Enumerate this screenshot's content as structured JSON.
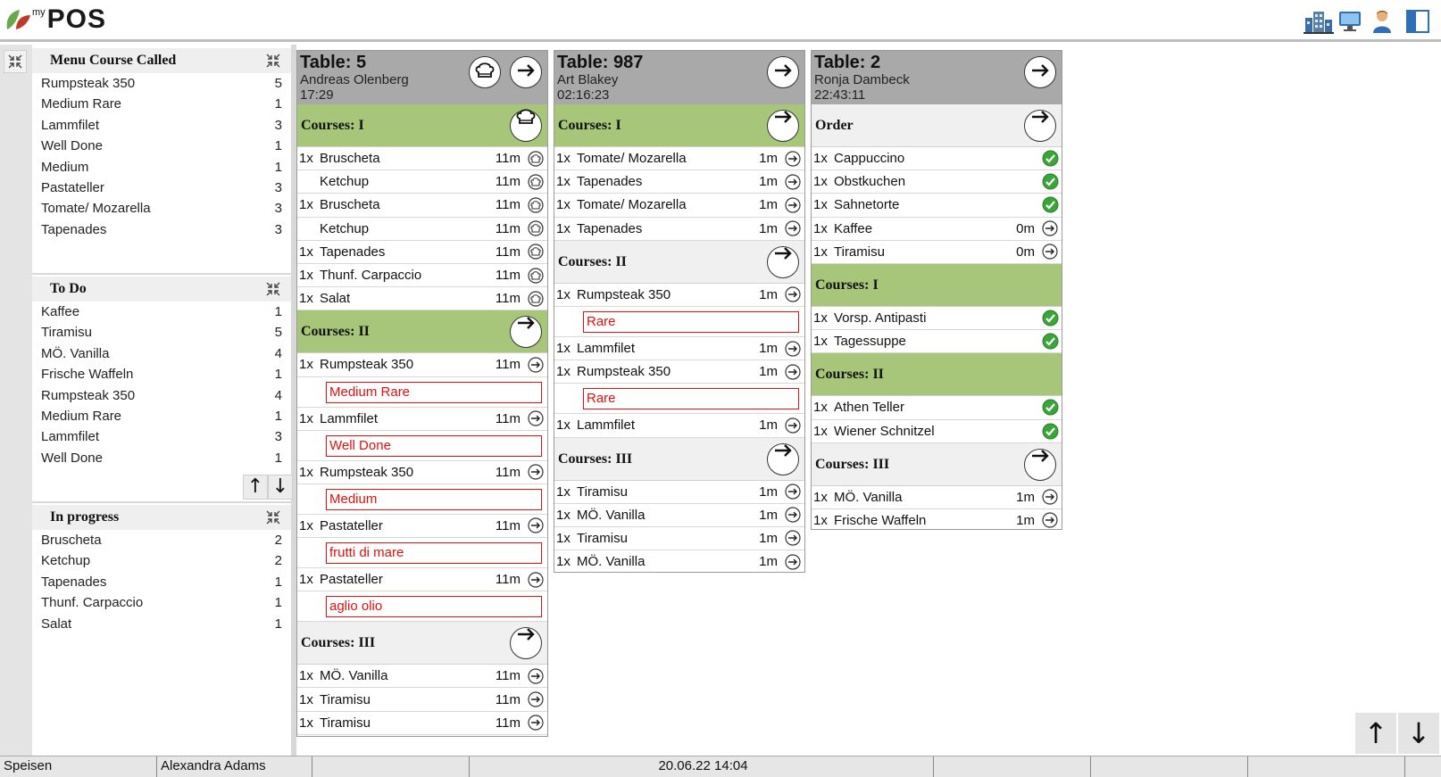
{
  "app": {
    "logo_my": "my",
    "logo_name": "POS"
  },
  "top_icons": [
    "building-icon",
    "monitor-icon",
    "user-icon",
    "panel-icon"
  ],
  "sidebar": {
    "menu": {
      "title": "Menu Course Called",
      "rows": [
        [
          "Rumpsteak 350",
          "5"
        ],
        [
          "Medium Rare",
          "1"
        ],
        [
          "Lammfilet",
          "3"
        ],
        [
          "Well Done",
          "1"
        ],
        [
          "Medium",
          "1"
        ],
        [
          "Pastateller",
          "3"
        ],
        [
          "Tomate/ Mozarella",
          "3"
        ],
        [
          "Tapenades",
          "3"
        ]
      ]
    },
    "todo": {
      "title": "To Do",
      "rows": [
        [
          "Kaffee",
          "1"
        ],
        [
          "Tiramisu",
          "5"
        ],
        [
          "MÖ. Vanilla",
          "4"
        ],
        [
          "Frische Waffeln",
          "1"
        ],
        [
          "Rumpsteak 350",
          "4"
        ],
        [
          "Medium Rare",
          "1"
        ],
        [
          "Lammfilet",
          "3"
        ],
        [
          "Well Done",
          "1"
        ]
      ]
    },
    "progress": {
      "title": "In progress",
      "rows": [
        [
          "Bruscheta",
          "2"
        ],
        [
          "Ketchup",
          "2"
        ],
        [
          "Tapenades",
          "1"
        ],
        [
          "Thunf. Carpaccio",
          "1"
        ],
        [
          "Salat",
          "1"
        ]
      ]
    },
    "scroll_up": "↑",
    "scroll_down": "↓"
  },
  "cards": [
    {
      "title": "Table: 5",
      "waiter": "Andreas Olenberg",
      "time": "17:29",
      "sections": [
        {
          "label": "Courses: I",
          "style": "green",
          "btn": "chef",
          "items": [
            {
              "q": "1x",
              "n": "Bruscheta",
              "t": "11m",
              "icon": "chef"
            },
            {
              "q": "",
              "n": "Ketchup",
              "t": "11m",
              "icon": "chef"
            },
            {
              "q": "1x",
              "n": "Bruscheta",
              "t": "11m",
              "icon": "chef"
            },
            {
              "q": "",
              "n": "Ketchup",
              "t": "11m",
              "icon": "chef"
            },
            {
              "q": "1x",
              "n": "Tapenades",
              "t": "11m",
              "icon": "chef"
            },
            {
              "q": "1x",
              "n": "Thunf. Carpaccio",
              "t": "11m",
              "icon": "chef"
            },
            {
              "q": "1x",
              "n": "Salat",
              "t": "11m",
              "icon": "chef"
            }
          ]
        },
        {
          "label": "Courses: II",
          "style": "green",
          "btn": "arrow",
          "items": [
            {
              "q": "1x",
              "n": "Rumpsteak 350",
              "t": "11m",
              "icon": "arrow",
              "note": "Medium Rare"
            },
            {
              "q": "1x",
              "n": "Lammfilet",
              "t": "11m",
              "icon": "arrow",
              "note": "Well Done"
            },
            {
              "q": "1x",
              "n": "Rumpsteak 350",
              "t": "11m",
              "icon": "arrow",
              "note": "Medium"
            },
            {
              "q": "1x",
              "n": "Pastateller",
              "t": "11m",
              "icon": "arrow",
              "note": "frutti di mare"
            },
            {
              "q": "1x",
              "n": "Pastateller",
              "t": "11m",
              "icon": "arrow",
              "note": "aglio olio"
            }
          ]
        },
        {
          "label": "Courses: III",
          "style": "gray",
          "btn": "arrow",
          "items": [
            {
              "q": "1x",
              "n": "MÖ. Vanilla",
              "t": "11m",
              "icon": "arrow"
            },
            {
              "q": "1x",
              "n": "Tiramisu",
              "t": "11m",
              "icon": "arrow"
            },
            {
              "q": "1x",
              "n": "Tiramisu",
              "t": "11m",
              "icon": "arrow"
            }
          ]
        }
      ]
    },
    {
      "title": "Table: 987",
      "waiter": "Art Blakey",
      "time": "02:16:23",
      "sections": [
        {
          "label": "Courses: I",
          "style": "green",
          "btn": "arrow",
          "items": [
            {
              "q": "1x",
              "n": "Tomate/ Mozarella",
              "t": "1m",
              "icon": "arrow"
            },
            {
              "q": "1x",
              "n": "Tapenades",
              "t": "1m",
              "icon": "arrow"
            },
            {
              "q": "1x",
              "n": "Tomate/ Mozarella",
              "t": "1m",
              "icon": "arrow"
            },
            {
              "q": "1x",
              "n": "Tapenades",
              "t": "1m",
              "icon": "arrow"
            }
          ]
        },
        {
          "label": "Courses: II",
          "style": "gray",
          "btn": "arrow",
          "items": [
            {
              "q": "1x",
              "n": "Rumpsteak 350",
              "t": "1m",
              "icon": "arrow",
              "note": "Rare"
            },
            {
              "q": "1x",
              "n": "Lammfilet",
              "t": "1m",
              "icon": "arrow"
            },
            {
              "q": "1x",
              "n": "Rumpsteak 350",
              "t": "1m",
              "icon": "arrow",
              "note": "Rare"
            },
            {
              "q": "1x",
              "n": "Lammfilet",
              "t": "1m",
              "icon": "arrow"
            }
          ]
        },
        {
          "label": "Courses: III",
          "style": "gray",
          "btn": "arrow",
          "items": [
            {
              "q": "1x",
              "n": "Tiramisu",
              "t": "1m",
              "icon": "arrow"
            },
            {
              "q": "1x",
              "n": "MÖ. Vanilla",
              "t": "1m",
              "icon": "arrow"
            },
            {
              "q": "1x",
              "n": "Tiramisu",
              "t": "1m",
              "icon": "arrow"
            },
            {
              "q": "1x",
              "n": "MÖ. Vanilla",
              "t": "1m",
              "icon": "arrow"
            }
          ]
        }
      ]
    },
    {
      "title": "Table: 2",
      "waiter": "Ronja Dambeck",
      "time": "22:43:11",
      "sections": [
        {
          "label": "Order",
          "style": "gray",
          "btn": "arrow",
          "items": [
            {
              "q": "1x",
              "n": "Cappuccino",
              "t": "",
              "icon": "check"
            },
            {
              "q": "1x",
              "n": "Obstkuchen",
              "t": "",
              "icon": "check"
            },
            {
              "q": "1x",
              "n": "Sahnetorte",
              "t": "",
              "icon": "check"
            },
            {
              "q": "1x",
              "n": "Kaffee",
              "t": "0m",
              "icon": "arrow"
            },
            {
              "q": "1x",
              "n": "Tiramisu",
              "t": "0m",
              "icon": "arrow"
            }
          ]
        },
        {
          "label": "Courses: I",
          "style": "green",
          "btn": "",
          "items": [
            {
              "q": "1x",
              "n": "Vorsp. Antipasti",
              "t": "",
              "icon": "check"
            },
            {
              "q": "1x",
              "n": "Tagessuppe",
              "t": "",
              "icon": "check"
            }
          ]
        },
        {
          "label": "Courses: II",
          "style": "green",
          "btn": "",
          "items": [
            {
              "q": "1x",
              "n": "Athen Teller",
              "t": "",
              "icon": "check"
            },
            {
              "q": "1x",
              "n": "Wiener Schnitzel",
              "t": "",
              "icon": "check"
            }
          ]
        },
        {
          "label": "Courses: III",
          "style": "gray",
          "btn": "arrow",
          "items": [
            {
              "q": "1x",
              "n": "MÖ. Vanilla",
              "t": "1m",
              "icon": "arrow"
            },
            {
              "q": "1x",
              "n": "Frische Waffeln",
              "t": "1m",
              "icon": "arrow"
            }
          ]
        }
      ]
    }
  ],
  "page_up": "↑",
  "page_down": "↓",
  "status": {
    "station": "Speisen",
    "user": "Alexandra Adams",
    "datetime": "20.06.22  14:04"
  },
  "colors": {
    "course_green": "#a8c67a",
    "note_red": "#e01010",
    "check_green": "#3aa63a",
    "header_gray": "#a9a9a9"
  }
}
